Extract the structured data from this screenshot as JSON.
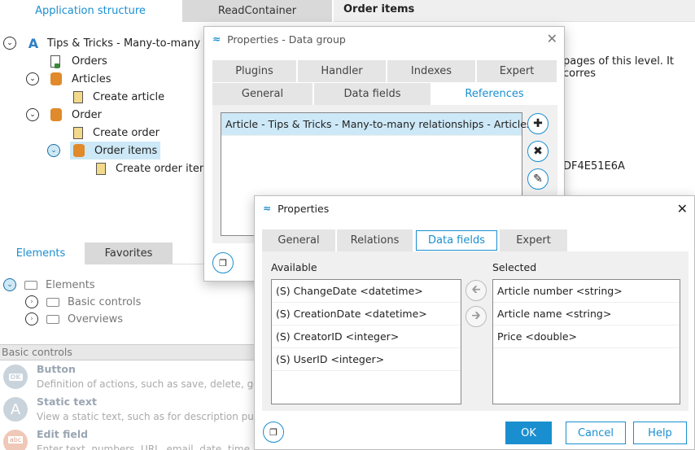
{
  "top_tabs": [
    "Application structure",
    "ReadContainer"
  ],
  "panel_header": "Order items",
  "tree": [
    {
      "label": "Tips & Tricks - Many-to-many re"
    },
    {
      "label": "Orders"
    },
    {
      "label": "Articles"
    },
    {
      "label": "Create article"
    },
    {
      "label": "Order"
    },
    {
      "label": "Create order"
    },
    {
      "label": "Order items"
    },
    {
      "label": "Create order item"
    }
  ],
  "bg_text": {
    "line1": "pages of this level. It corres",
    "line2": "DF4E51E6A"
  },
  "bottom_tabs": [
    "Elements",
    "Favorites"
  ],
  "elements_tree": [
    "Elements",
    "Basic controls",
    "Overviews"
  ],
  "basic_controls_header": "Basic controls",
  "controls": [
    {
      "icon": "OK",
      "title": "Button",
      "desc": "Definition of actions, such as save, delete, go"
    },
    {
      "icon": "A",
      "title": "Static text",
      "desc": "View a static text, such as for description purp"
    },
    {
      "icon": "abc",
      "title": "Edit field",
      "desc": "Enter text, numbers, URL, email, date, time"
    }
  ],
  "dialog1": {
    "title": "Properties - Data group",
    "tabs_row1": [
      "Plugins",
      "Handler",
      "Indexes",
      "Expert"
    ],
    "tabs_row2": [
      "General",
      "Data fields",
      "References"
    ],
    "list": [
      "Article - Tips & Tricks - Many-to-many relationships - Articles"
    ]
  },
  "dialog2": {
    "title": "Properties",
    "tabs": [
      "General",
      "Relations",
      "Data fields",
      "Expert"
    ],
    "available_label": "Available",
    "selected_label": "Selected",
    "available": [
      "(S) ChangeDate <datetime>",
      "(S) CreationDate <datetime>",
      "(S) CreatorID <integer>",
      "(S) UserID <integer>"
    ],
    "selected": [
      "Article number <string>",
      "Article name <string>",
      "Price <double>"
    ],
    "ok": "OK",
    "cancel": "Cancel",
    "help": "Help"
  }
}
